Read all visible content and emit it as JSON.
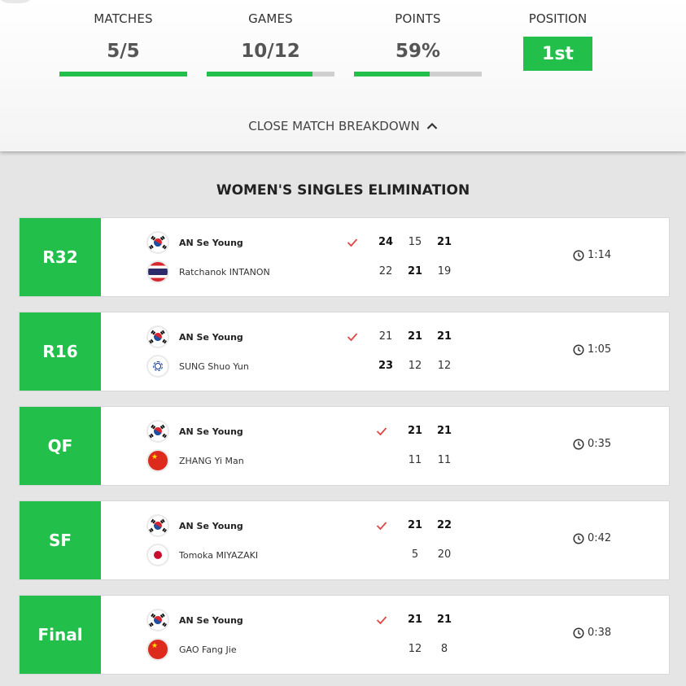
{
  "stats": {
    "matches": {
      "label": "MATCHES",
      "value": "5/5",
      "progress": 1.0
    },
    "games": {
      "label": "GAMES",
      "value": "10/12",
      "progress": 0.83
    },
    "points": {
      "label": "POINTS",
      "value": "59%",
      "progress": 0.59
    },
    "position": {
      "label": "POSITION",
      "value": "1st"
    }
  },
  "toggle_label": "CLOSE MATCH BREAKDOWN",
  "section_title": "WOMEN'S SINGLES ELIMINATION",
  "colors": {
    "accent": "#22c04b",
    "check": "#e04848"
  },
  "matches": [
    {
      "round": "R32",
      "time": "1:14",
      "p1": {
        "name": "AN Se Young",
        "flag": "korea-flag-icon",
        "scores": [
          "24",
          "15",
          "21"
        ]
      },
      "p2": {
        "name": "Ratchanok INTANON",
        "flag": "thailand-flag-icon",
        "scores": [
          "22",
          "21",
          "19"
        ]
      }
    },
    {
      "round": "R16",
      "time": "1:05",
      "p1": {
        "name": "AN Se Young",
        "flag": "korea-flag-icon",
        "scores": [
          "21",
          "21",
          "21"
        ]
      },
      "p2": {
        "name": "SUNG Shuo Yun",
        "flag": "chinese-taipei-flag-icon",
        "scores": [
          "23",
          "12",
          "12"
        ]
      }
    },
    {
      "round": "QF",
      "time": "0:35",
      "p1": {
        "name": "AN Se Young",
        "flag": "korea-flag-icon",
        "scores": [
          "21",
          "21"
        ]
      },
      "p2": {
        "name": "ZHANG Yi Man",
        "flag": "china-flag-icon",
        "scores": [
          "11",
          "11"
        ]
      }
    },
    {
      "round": "SF",
      "time": "0:42",
      "p1": {
        "name": "AN Se Young",
        "flag": "korea-flag-icon",
        "scores": [
          "21",
          "22"
        ]
      },
      "p2": {
        "name": "Tomoka MIYAZAKI",
        "flag": "japan-flag-icon",
        "scores": [
          "5",
          "20"
        ]
      }
    },
    {
      "round": "Final",
      "time": "0:38",
      "p1": {
        "name": "AN Se Young",
        "flag": "korea-flag-icon",
        "scores": [
          "21",
          "21"
        ]
      },
      "p2": {
        "name": "GAO Fang Jie",
        "flag": "china-flag-icon",
        "scores": [
          "12",
          "8"
        ]
      }
    }
  ]
}
